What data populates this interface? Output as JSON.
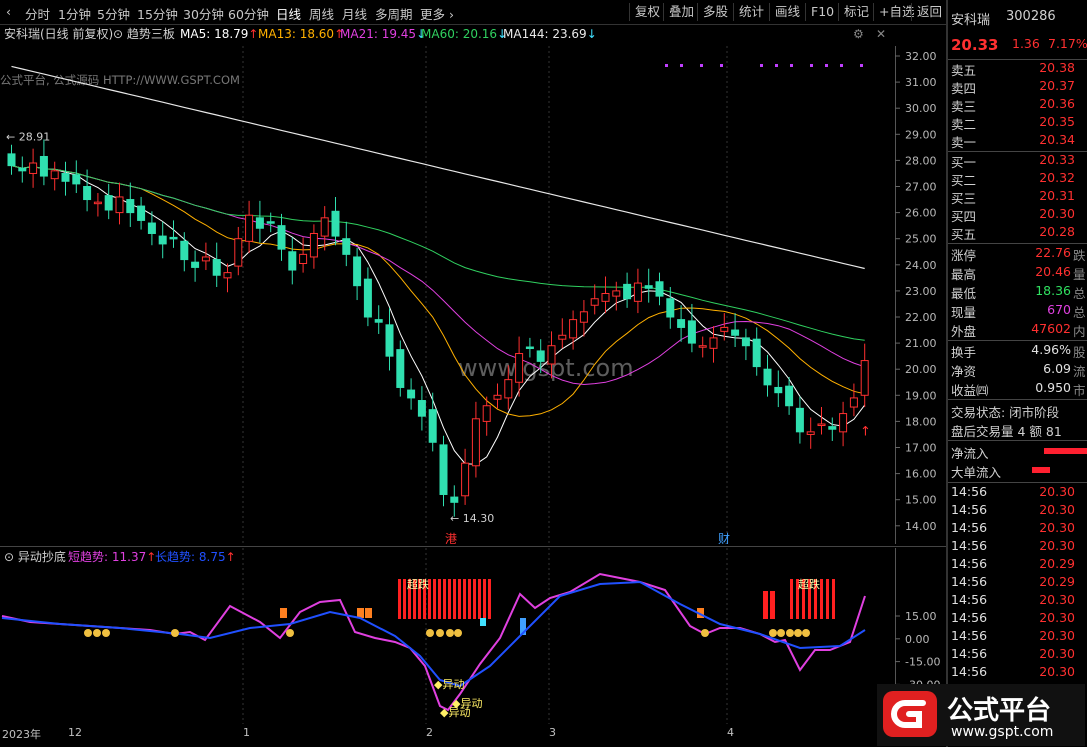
{
  "toolbar": {
    "periods": [
      {
        "label": "分时",
        "active": false
      },
      {
        "label": "1分钟",
        "active": false
      },
      {
        "label": "5分钟",
        "active": false
      },
      {
        "label": "15分钟",
        "active": false
      },
      {
        "label": "30分钟",
        "active": false
      },
      {
        "label": "60分钟",
        "active": false
      },
      {
        "label": "日线",
        "active": true
      },
      {
        "label": "周线",
        "active": false
      },
      {
        "label": "月线",
        "active": false
      },
      {
        "label": "多周期",
        "active": false
      }
    ],
    "more": "更多",
    "right_buttons": [
      "复权",
      "叠加",
      "多股",
      "统计",
      "画线",
      "F10",
      "标记",
      "+自选",
      "返回"
    ]
  },
  "chart_data": [
    {
      "type": "line",
      "title": "安科瑞(日线 前复权)",
      "indicators": [
        {
          "name": "MA5",
          "value": "18.79",
          "arrow": "↑",
          "color": "#ffffff"
        },
        {
          "name": "MA13",
          "value": "18.60",
          "arrow": "↑",
          "color": "#ffb000"
        },
        {
          "name": "MA21",
          "value": "19.45",
          "arrow": "↓",
          "color": "#e040e0"
        },
        {
          "name": "MA60",
          "value": "20.16",
          "arrow": "↓",
          "color": "#30d060"
        },
        {
          "name": "MA144",
          "value": "23.69",
          "arrow": "↓",
          "color": "#e8e8e8"
        }
      ],
      "y_ticks": [
        "32.00",
        "31.00",
        "30.00",
        "29.00",
        "28.00",
        "27.00",
        "26.00",
        "25.00",
        "24.00",
        "23.00",
        "22.00",
        "21.00",
        "20.00",
        "19.00",
        "18.00",
        "17.00",
        "16.00",
        "15.00",
        "14.00"
      ],
      "annotations": {
        "high": "28.91",
        "low": "14.30",
        "event_port": "港",
        "event_fin": "财"
      },
      "closes": [
        27.8,
        27.6,
        27.9,
        27.4,
        27.6,
        27.2,
        27.1,
        26.5,
        26.4,
        26.1,
        26.6,
        26.0,
        25.7,
        25.2,
        24.8,
        25.0,
        24.2,
        23.9,
        24.3,
        23.6,
        23.7,
        25.0,
        25.9,
        25.4,
        25.6,
        24.6,
        23.8,
        24.4,
        25.2,
        25.8,
        25.1,
        24.4,
        23.2,
        22.0,
        21.8,
        20.5,
        19.3,
        18.9,
        18.2,
        17.2,
        15.2,
        14.9,
        16.4,
        18.1,
        18.6,
        19.0,
        19.6,
        20.6,
        20.8,
        20.3,
        20.9,
        21.3,
        21.9,
        22.2,
        22.7,
        22.9,
        23.0,
        22.7,
        23.3,
        23.1,
        22.8,
        22.0,
        21.6,
        21.0,
        20.9,
        21.2,
        21.6,
        21.3,
        20.9,
        20.1,
        19.4,
        19.1,
        18.6,
        17.6,
        17.6,
        17.9,
        17.7,
        18.3,
        18.9,
        20.33
      ]
    },
    {
      "type": "line",
      "title": "异动抄底",
      "series": [
        {
          "name": "短趋势",
          "value": "11.37"
        },
        {
          "name": "长趋势",
          "value": "8.75"
        }
      ],
      "y_ticks": [
        "15.00",
        "0.00",
        "-15.00",
        "-30.00"
      ],
      "labels": {
        "signal": "异动",
        "overbought": "超跌"
      }
    }
  ],
  "x_axis": [
    "2023年",
    "12",
    "1",
    "2",
    "3",
    "4"
  ],
  "quote": {
    "name": "安科瑞",
    "code": "300286",
    "price": "20.33",
    "change": "1.36",
    "change_pct": "7.17%",
    "asks": [
      {
        "label": "卖五",
        "price": "20.38"
      },
      {
        "label": "卖四",
        "price": "20.37"
      },
      {
        "label": "卖三",
        "price": "20.36"
      },
      {
        "label": "卖二",
        "price": "20.35"
      },
      {
        "label": "卖一",
        "price": "20.34"
      }
    ],
    "bids": [
      {
        "label": "买一",
        "price": "20.33"
      },
      {
        "label": "买二",
        "price": "20.32"
      },
      {
        "label": "买三",
        "price": "20.31"
      },
      {
        "label": "买四",
        "price": "20.30"
      },
      {
        "label": "买五",
        "price": "20.28"
      }
    ],
    "limit_up": {
      "label": "涨停",
      "value": "22.76",
      "suffix": "跌"
    },
    "high": {
      "label": "最高",
      "value": "20.46",
      "suffix": "量"
    },
    "low": {
      "label": "最低",
      "value": "18.36",
      "suffix": "总"
    },
    "current_vol": {
      "label": "现量",
      "value": "670",
      "suffix": "总"
    },
    "outer": {
      "label": "外盘",
      "value": "47602",
      "suffix": "内"
    },
    "turnover": {
      "label": "换手",
      "value": "4.96%",
      "suffix": "股"
    },
    "net_assets": {
      "label": "净资",
      "value": "6.09",
      "suffix": "流"
    },
    "eps": {
      "label": "收益㈣",
      "value": "0.950",
      "suffix": "市"
    },
    "trade_status": "交易状态: 闭市阶段",
    "after_hours": "盘后交易量 4 额 81",
    "net_inflow": "净流入",
    "big_inflow": "大单流入",
    "ticks": [
      {
        "time": "14:56",
        "price": "20.30"
      },
      {
        "time": "14:56",
        "price": "20.30"
      },
      {
        "time": "14:56",
        "price": "20.30"
      },
      {
        "time": "14:56",
        "price": "20.30"
      },
      {
        "time": "14:56",
        "price": "20.29"
      },
      {
        "time": "14:56",
        "price": "20.29"
      },
      {
        "time": "14:56",
        "price": "20.30"
      },
      {
        "time": "14:56",
        "price": "20.30"
      },
      {
        "time": "14:56",
        "price": "20.30"
      },
      {
        "time": "14:56",
        "price": "20.30"
      },
      {
        "time": "14:56",
        "price": "20.30"
      }
    ]
  },
  "watermark": "www.gspt.com",
  "watermark2": "公式平台, 公式源码 HTTP://WWW.GSPT.COM",
  "logo": {
    "text": "公式平台",
    "url": "www.gspt.com"
  },
  "colors": {
    "up": "#ff3030",
    "down": "#30e0b0",
    "white": "#ffffff",
    "accent_red": "#ff2020"
  }
}
